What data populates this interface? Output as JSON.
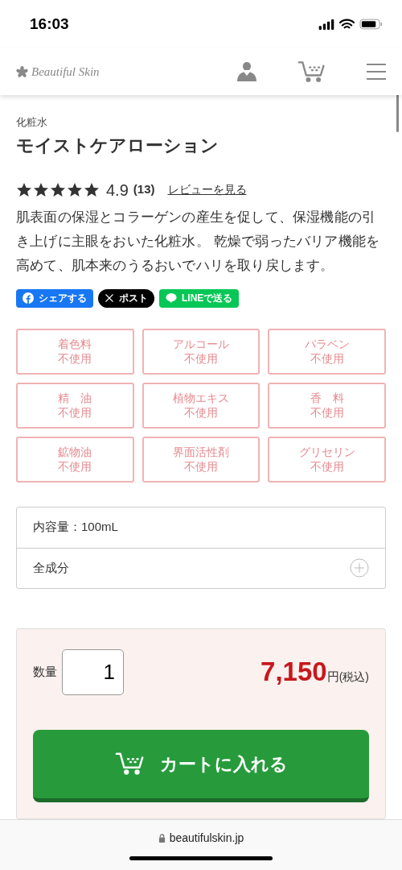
{
  "status_bar": {
    "time": "16:03"
  },
  "header": {
    "logo": "Beautiful Skin"
  },
  "product": {
    "category": "化粧水",
    "title": "モイストケアローション"
  },
  "rating": {
    "stars": 5,
    "score": "4.9",
    "count": "(13)",
    "link": "レビューを見る"
  },
  "description": "肌表面の保湿とコラーゲンの産生を促して、保湿機能の引き上げに主眼をおいた化粧水。 乾燥で弱ったバリア機能を高めて、肌本来のうるおいでハリを取り戻します。",
  "share": [
    {
      "kind": "facebook",
      "label": "シェアする"
    },
    {
      "kind": "x",
      "label": "ポスト"
    },
    {
      "kind": "line",
      "label": "LINEで送る"
    }
  ],
  "free_from": [
    {
      "name": "着色料",
      "label": "不使用"
    },
    {
      "name": "アルコール",
      "label": "不使用"
    },
    {
      "name": "パラベン",
      "label": "不使用"
    },
    {
      "name": "精　油",
      "label": "不使用"
    },
    {
      "name": "植物エキス",
      "label": "不使用"
    },
    {
      "name": "香　料",
      "label": "不使用"
    },
    {
      "name": "鉱物油",
      "label": "不使用"
    },
    {
      "name": "界面活性剤",
      "label": "不使用"
    },
    {
      "name": "グリセリン",
      "label": "不使用"
    }
  ],
  "specs": [
    {
      "kind": "text",
      "label": "内容量：100mL"
    },
    {
      "kind": "accordion",
      "label": "全成分",
      "expanded": false
    }
  ],
  "purchase": {
    "quantity_label": "数量",
    "quantity": "1",
    "price": "7,150",
    "currency": "円",
    "tax": "(税込)",
    "cart_button": "カートに入れる"
  },
  "browser": {
    "url": "beautifulskin.jp"
  }
}
